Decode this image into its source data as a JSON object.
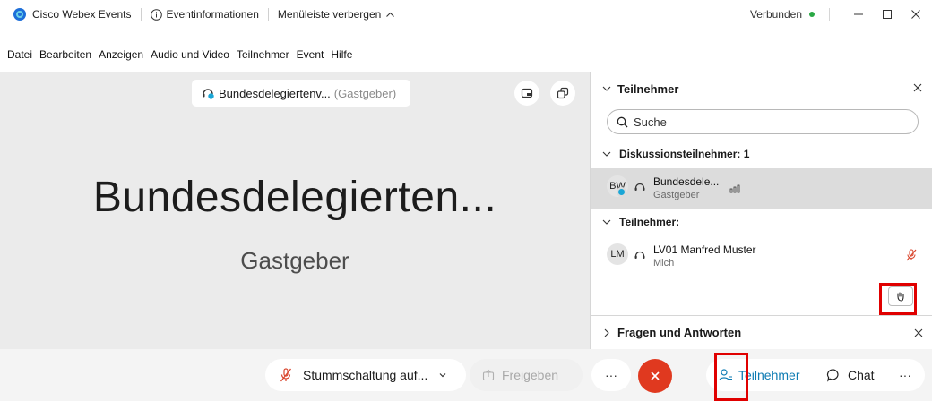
{
  "titlebar": {
    "app_name": "Cisco Webex Events",
    "event_info": "Eventinformationen",
    "hide_menu": "Menüleiste verbergen",
    "status": "Verbunden",
    "status_color": "#2aa845"
  },
  "menubar": {
    "items": [
      "Datei",
      "Bearbeiten",
      "Anzeigen",
      "Audio und Video",
      "Teilnehmer",
      "Event",
      "Hilfe"
    ]
  },
  "stage": {
    "chip_name": "Bundesdelegiertenv...",
    "chip_role": "(Gastgeber)",
    "big_name": "Bundesdelegierten...",
    "big_role": "Gastgeber"
  },
  "panel": {
    "title": "Teilnehmer",
    "search_placeholder": "Suche",
    "panelists_header": "Diskussionsteilnehmer: 1",
    "attendees_header": "Teilnehmer:",
    "panelist": {
      "initials": "BW",
      "name": "Bundesdele...",
      "role": "Gastgeber"
    },
    "attendee": {
      "initials": "LM",
      "name": "LV01 Manfred Muster",
      "role": "Mich"
    },
    "qa_title": "Fragen und Antworten"
  },
  "bottombar": {
    "mute_label": "Stummschaltung auf...",
    "share_label": "Freigeben",
    "more_label": "···",
    "participants_label": "Teilnehmer",
    "chat_label": "Chat",
    "more2_label": "···"
  },
  "colors": {
    "accent": "#0d7bb3",
    "end_call": "#e0391f",
    "highlight": "#e00000",
    "muted": "#d9462e"
  }
}
